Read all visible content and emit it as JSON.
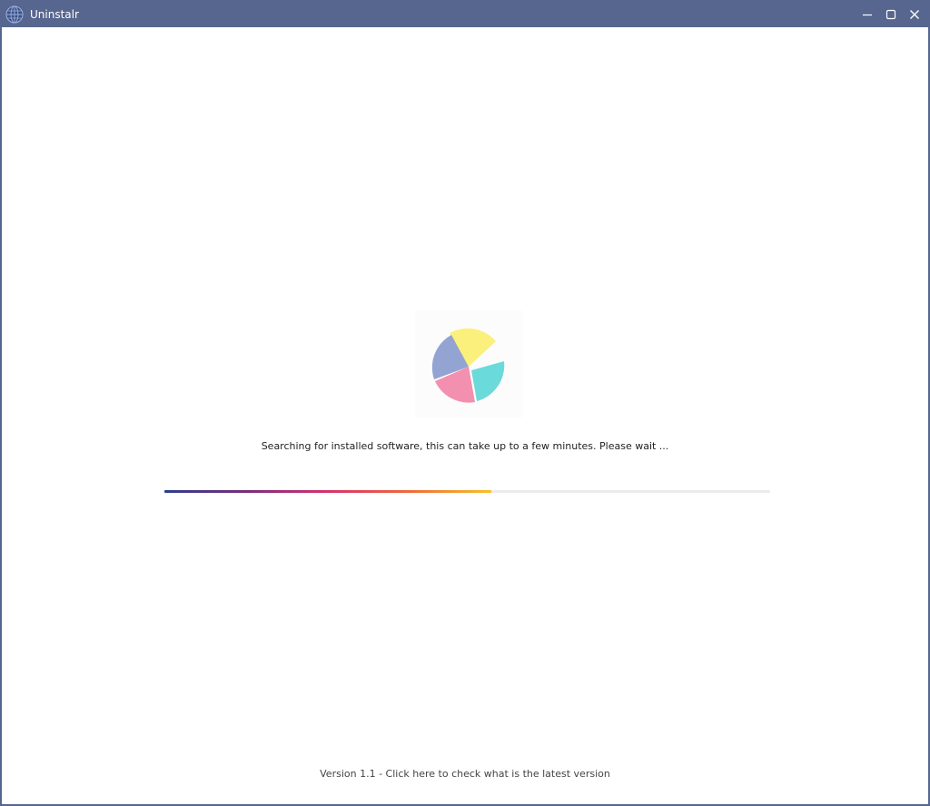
{
  "window": {
    "title": "Uninstalr",
    "icon": "globe-icon",
    "controls": [
      "minimize-icon",
      "maximize-icon",
      "close-icon"
    ]
  },
  "main": {
    "loader_icon": "pie-chart-spinner-icon",
    "status_text": "Searching for installed software, this can take up to a few minutes. Please wait ...",
    "progress_percent": 54
  },
  "footer": {
    "version_text": "Version 1.1 - Click here to check what is the latest version"
  },
  "colors": {
    "titlebar": "#56668e",
    "progress_start": "#2c3e8c",
    "progress_end": "#f7c12a",
    "pie_yellow": "#fbf07c",
    "pie_teal": "#62d8d8",
    "pie_pink": "#f289ab",
    "pie_blue": "#8e9fd0"
  }
}
